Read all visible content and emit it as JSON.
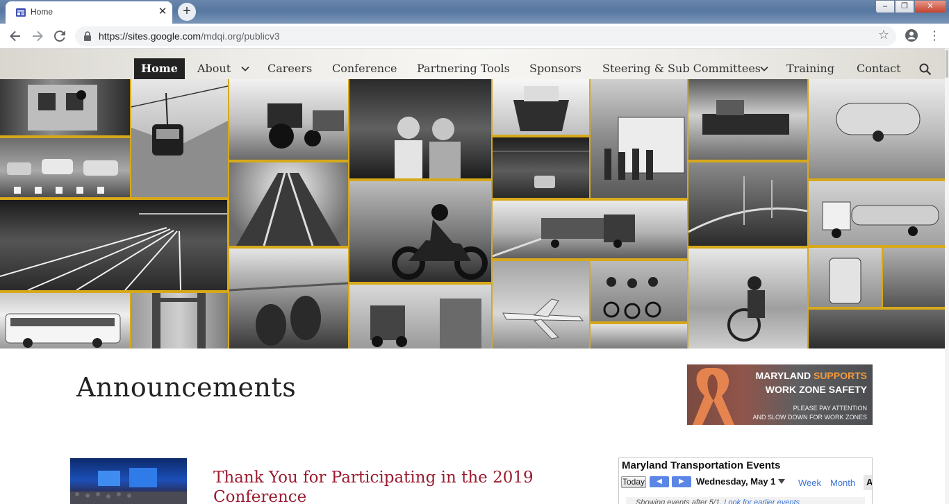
{
  "browser": {
    "tab_title": "Home",
    "url_host": "https://sites.google.com",
    "url_path": "/mdqi.org/publicv3",
    "icons": {
      "back": "back-arrow-icon",
      "forward": "forward-arrow-icon",
      "reload": "reload-icon",
      "lock": "lock-icon",
      "star": "bookmark-star-icon",
      "profile": "profile-icon",
      "menu": "kebab-menu-icon"
    }
  },
  "nav": {
    "items": [
      {
        "label": "Home",
        "active": true
      },
      {
        "label": "About",
        "has_dropdown": true
      },
      {
        "label": "Careers"
      },
      {
        "label": "Conference"
      },
      {
        "label": "Partnering Tools"
      },
      {
        "label": "Sponsors"
      },
      {
        "label": "Steering & Sub Committees",
        "has_dropdown": true
      },
      {
        "label": "Training"
      },
      {
        "label": "Contact"
      }
    ]
  },
  "main": {
    "heading": "Announcements",
    "post_title": "Thank You for Participating in the 2019 Conference"
  },
  "banner": {
    "line1_a": "MARYLAND",
    "line1_b": "SUPPORTS",
    "line2": "WORK ZONE SAFETY",
    "line3": "PLEASE PAY ATTENTION",
    "line4": "AND SLOW DOWN FOR WORK ZONES"
  },
  "calendar": {
    "title": "Maryland Transportation Events",
    "today_label": "Today",
    "date_label": "Wednesday, May 1",
    "week_label": "Week",
    "month_label": "Month",
    "agenda_label": "A",
    "note_text": "Showing events after 5/1.",
    "note_link": "Look for earlier events"
  },
  "colors": {
    "accent_post_title": "#9b1b30",
    "mosaic_border": "#d7a91a",
    "calendar_arrow": "#5b86e5",
    "banner_orange": "#f39a3b"
  }
}
